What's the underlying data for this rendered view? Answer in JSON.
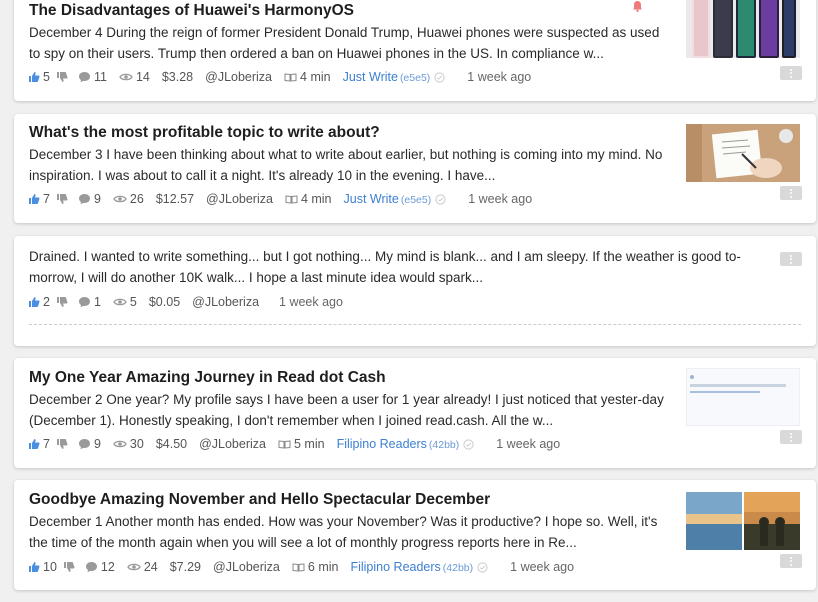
{
  "articles": [
    {
      "title": "The Disadvantages of Huawei's HarmonyOS",
      "excerpt": "December 4 During the reign of former President Donald Trump, Huawei phones were suspected as used to spy on their users. Trump then ordered a ban on Huawei phones in the US. In compliance w...",
      "likes": "5",
      "comments": "11",
      "views": "14",
      "earnings": "$3.28",
      "author": "@JLoberiza",
      "read_time": "4 min",
      "community": "Just Write",
      "community_id": "(e5e5)",
      "time": "1 week ago",
      "image": "phones-thumbnail"
    },
    {
      "title": "What's the most profitable topic to write about?",
      "excerpt": "December 3 I have been thinking about what to write about earlier, but nothing is coming into my mind. No inspiration. I was about to call it a night. It's already 10 in the evening. I have...",
      "likes": "7",
      "comments": "9",
      "views": "26",
      "earnings": "$12.57",
      "author": "@JLoberiza",
      "read_time": "4 min",
      "community": "Just Write",
      "community_id": "(e5e5)",
      "time": "1 week ago",
      "image": "writing-desk-thumbnail"
    },
    {
      "excerpt": "Drained. I wanted to write something... but I got nothing... My mind is blank... and I am sleepy. If the weather is good to-morrow, I will do another 10K walk... I hope a last minute idea would spark...",
      "likes": "2",
      "comments": "1",
      "views": "5",
      "earnings": "$0.05",
      "author": "@JLoberiza",
      "time": "1 week ago"
    },
    {
      "title": "My One Year Amazing Journey in Read dot Cash",
      "excerpt": "December 2 One year? My profile says I have been a user for 1 year already! I just noticed that yester-day (December 1). Honestly speaking, I don't remember when I joined read.cash. All the w...",
      "likes": "7",
      "comments": "9",
      "views": "30",
      "earnings": "$4.50",
      "author": "@JLoberiza",
      "read_time": "5 min",
      "community": "Filipino Readers",
      "community_id": "(42bb)",
      "time": "1 week ago",
      "image": "profile-screenshot-thumbnail"
    },
    {
      "title": "Goodbye Amazing November and Hello Spectacular December",
      "excerpt": "December 1 Another month has ended. How was your November? Was it productive? I hope so. Well, it's the time of the month again when you will see a lot of monthly progress reports here in Re...",
      "likes": "10",
      "comments": "12",
      "views": "24",
      "earnings": "$7.29",
      "author": "@JLoberiza",
      "read_time": "6 min",
      "community": "Filipino Readers",
      "community_id": "(42bb)",
      "time": "1 week ago",
      "image": "sunset-collage-thumbnail"
    }
  ],
  "colors": {
    "accent_blue": "#3d7fd1",
    "like_blue": "#4a8fe0",
    "icon_gray": "#9a9a9a",
    "bell_red": "#f07a7a",
    "menu_gray": "#d9d9d9"
  }
}
